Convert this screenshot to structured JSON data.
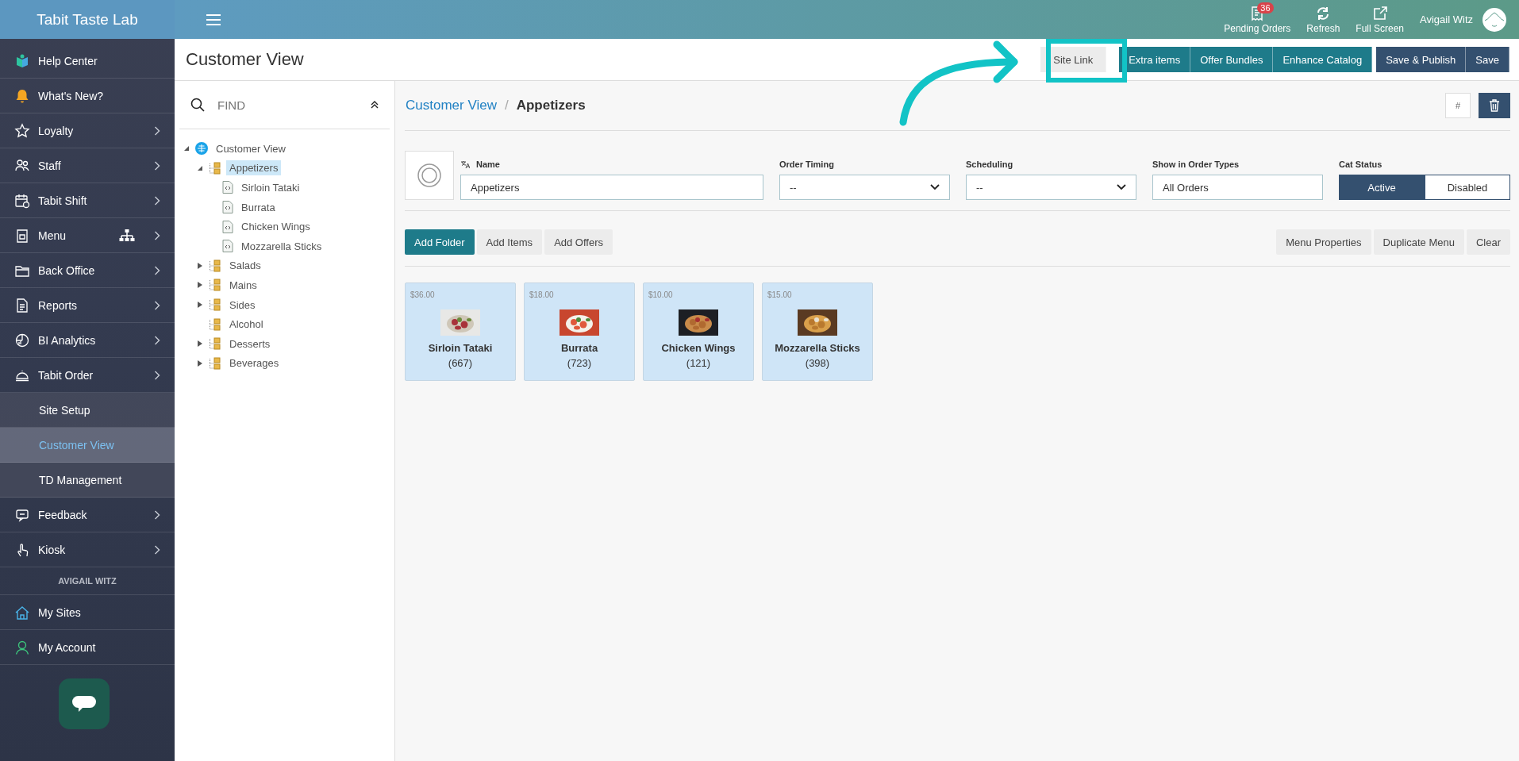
{
  "sidebar": {
    "brand": "Tabit Taste Lab",
    "items": [
      {
        "kind": "item",
        "label": "Help Center",
        "chevron": false
      },
      {
        "kind": "item",
        "label": "What's New?",
        "chevron": false
      },
      {
        "kind": "item",
        "label": "Loyalty",
        "chevron": true
      },
      {
        "kind": "item",
        "label": "Staff",
        "chevron": true
      },
      {
        "kind": "item",
        "label": "Tabit Shift",
        "chevron": true
      },
      {
        "kind": "item",
        "label": "Menu",
        "chevron": true
      },
      {
        "kind": "item",
        "label": "Back Office",
        "chevron": true
      },
      {
        "kind": "item",
        "label": "Reports",
        "chevron": true
      },
      {
        "kind": "item",
        "label": "BI Analytics",
        "chevron": true
      },
      {
        "kind": "item",
        "label": "Tabit Order",
        "chevron": true
      },
      {
        "kind": "subitem",
        "label": "Site Setup",
        "selected": false
      },
      {
        "kind": "subitem",
        "label": "Customer View",
        "selected": true
      },
      {
        "kind": "subitem",
        "label": "TD Management",
        "selected": false
      },
      {
        "kind": "item",
        "label": "Feedback",
        "chevron": true
      },
      {
        "kind": "item",
        "label": "Kiosk",
        "chevron": true
      },
      {
        "kind": "heading",
        "label": "AVIGAIL WITZ"
      },
      {
        "kind": "item",
        "label": "My Sites",
        "chevron": false
      },
      {
        "kind": "item",
        "label": "My Account",
        "chevron": false
      }
    ]
  },
  "topbar": {
    "actions": [
      {
        "label": "Pending Orders",
        "badge": "36"
      },
      {
        "label": "Refresh"
      },
      {
        "label": "Full Screen"
      }
    ],
    "user": "Avigail Witz"
  },
  "header": {
    "title": "Customer View",
    "buttons": [
      {
        "label": "Site Link",
        "kind": "light"
      },
      {
        "label": "Extra items",
        "kind": "teal"
      },
      {
        "label": "Offer Bundles",
        "kind": "teal"
      },
      {
        "label": "Enhance Catalog",
        "kind": "teal"
      },
      {
        "label": "Save & Publish",
        "kind": "dark"
      },
      {
        "label": "Save",
        "kind": "dark"
      }
    ]
  },
  "tree": {
    "search": {
      "placeholder": "FIND"
    },
    "nodes": [
      {
        "kind": "root",
        "label": "Customer View",
        "expanded": true,
        "selected": false,
        "children": [
          {
            "kind": "folder",
            "label": "Appetizers",
            "expanded": true,
            "selected": true,
            "children": [
              {
                "kind": "item",
                "label": "Sirloin Tataki",
                "selected": false
              },
              {
                "kind": "item",
                "label": "Burrata",
                "selected": false
              },
              {
                "kind": "item",
                "label": "Chicken Wings",
                "selected": false
              },
              {
                "kind": "item",
                "label": "Mozzarella Sticks",
                "selected": false
              }
            ]
          },
          {
            "kind": "folder",
            "label": "Salads",
            "expanded": false,
            "selected": false
          },
          {
            "kind": "folder",
            "label": "Mains",
            "expanded": false,
            "selected": false
          },
          {
            "kind": "folder",
            "label": "Sides",
            "expanded": false,
            "selected": false
          },
          {
            "kind": "folder",
            "label": "Alcohol",
            "selected": false
          },
          {
            "kind": "folder",
            "label": "Desserts",
            "expanded": false,
            "selected": false
          },
          {
            "kind": "folder",
            "label": "Beverages",
            "expanded": false,
            "selected": false
          }
        ]
      }
    ]
  },
  "breadcrumb": {
    "parent": "Customer View",
    "separator": "/",
    "current": "Appetizers",
    "hash_button": "#"
  },
  "form": {
    "name": {
      "label": "Name",
      "value": "Appetizers"
    },
    "order_timing": {
      "label": "Order Timing",
      "value": "--"
    },
    "scheduling": {
      "label": "Scheduling",
      "value": "--"
    },
    "order_types": {
      "label": "Show in Order Types",
      "value": "All Orders"
    },
    "status": {
      "label": "Cat Status",
      "options": [
        {
          "label": "Active",
          "selected": true
        },
        {
          "label": "Disabled",
          "selected": false
        }
      ]
    }
  },
  "actions": {
    "left": [
      {
        "label": "Add Folder",
        "selected": true
      },
      {
        "label": "Add Items",
        "selected": false
      },
      {
        "label": "Add Offers",
        "selected": false
      }
    ],
    "right": [
      "Menu Properties",
      "Duplicate Menu",
      "Clear"
    ]
  },
  "cards": [
    {
      "price": "$36.00",
      "name": "Sirloin Tataki",
      "count": "(667)",
      "kind": "picture"
    },
    {
      "price": "$18.00",
      "name": "Burrata",
      "count": "(723)",
      "kind": "picture"
    },
    {
      "price": "$10.00",
      "name": "Chicken Wings",
      "count": "(121)",
      "kind": "picture"
    },
    {
      "price": "$15.00",
      "name": "Mozzarella Sticks",
      "count": "(398)",
      "kind": "picture"
    }
  ]
}
